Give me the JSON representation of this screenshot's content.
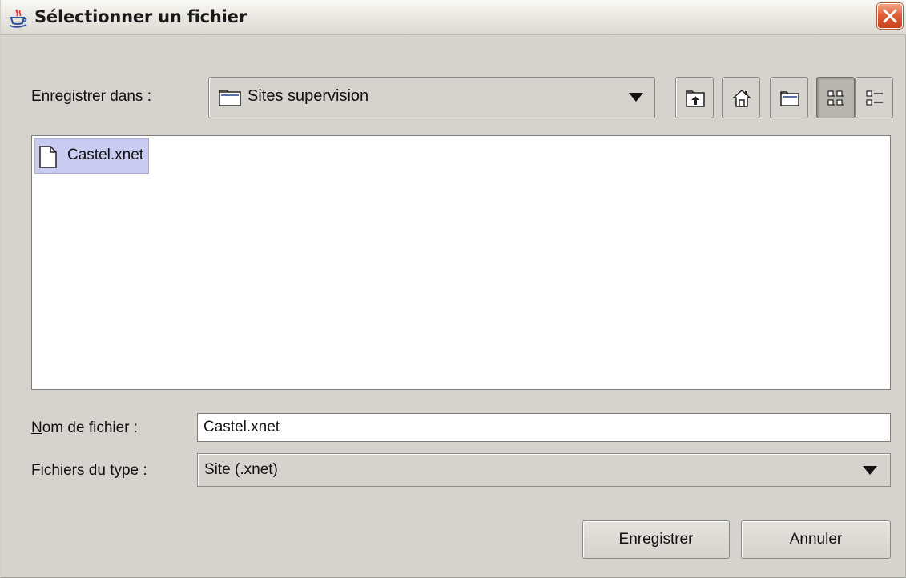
{
  "window": {
    "title": "Sélectionner un fichier",
    "app_icon": "java-coffee-icon",
    "close_icon": "close-icon"
  },
  "look_in": {
    "label_prefix": "Enreg",
    "label_mnemonic": "i",
    "label_suffix": "strer dans :",
    "folder_icon": "folder-icon",
    "value": "Sites supervision"
  },
  "toolbar": {
    "up_icon": "up-folder-icon",
    "home_icon": "home-icon",
    "new_folder_icon": "new-folder-icon",
    "list_view_icon": "list-view-icon",
    "details_view_icon": "details-view-icon",
    "active_view": "list"
  },
  "files": [
    {
      "name": "Castel.xnet",
      "icon": "file-icon",
      "selected": true
    }
  ],
  "file_name": {
    "label_mnemonic": "N",
    "label_suffix": "om de fichier :",
    "value": "Castel.xnet"
  },
  "file_type": {
    "label_prefix": "Fichiers du ",
    "label_mnemonic": "t",
    "label_suffix": "ype :",
    "value": "Site (.xnet)"
  },
  "buttons": {
    "save": "Enregistrer",
    "cancel": "Annuler"
  },
  "colors": {
    "selection": "#c9ccf0",
    "close_button": "#e0603a",
    "panel": "#d6d3ce"
  }
}
